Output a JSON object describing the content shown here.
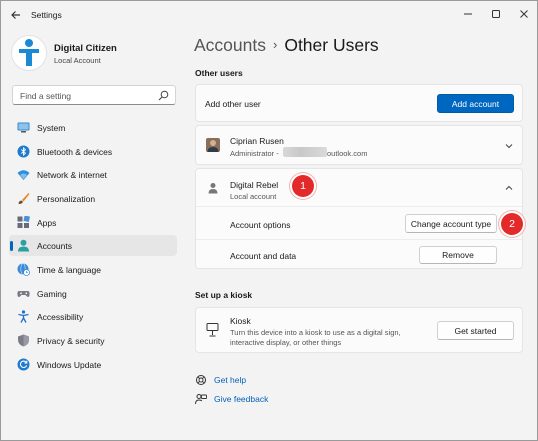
{
  "window": {
    "title": "Settings"
  },
  "profile": {
    "name": "Digital Citizen",
    "account_type": "Local Account"
  },
  "search": {
    "placeholder": "Find a setting"
  },
  "nav": {
    "items": [
      {
        "label": "System",
        "icon": "monitor-icon"
      },
      {
        "label": "Bluetooth & devices",
        "icon": "bluetooth-icon"
      },
      {
        "label": "Network & internet",
        "icon": "wifi-icon"
      },
      {
        "label": "Personalization",
        "icon": "brush-icon"
      },
      {
        "label": "Apps",
        "icon": "apps-icon"
      },
      {
        "label": "Accounts",
        "icon": "person-icon",
        "selected": true
      },
      {
        "label": "Time & language",
        "icon": "globe-clock-icon"
      },
      {
        "label": "Gaming",
        "icon": "gamepad-icon"
      },
      {
        "label": "Accessibility",
        "icon": "accessibility-icon"
      },
      {
        "label": "Privacy & security",
        "icon": "shield-icon"
      },
      {
        "label": "Windows Update",
        "icon": "update-icon"
      }
    ]
  },
  "breadcrumb": {
    "parent": "Accounts",
    "separator": "›",
    "current": "Other Users"
  },
  "other_users": {
    "heading": "Other users",
    "add_other_user_label": "Add other user",
    "add_account_button": "Add account",
    "users": [
      {
        "name": "Ciprian Rusen",
        "detail_prefix": "Administrator - ",
        "email_suffix": "outlook.com",
        "expanded": false
      },
      {
        "name": "Digital Rebel",
        "detail": "Local account",
        "expanded": true,
        "account_options_label": "Account options",
        "change_type_button": "Change account type",
        "account_data_label": "Account and data",
        "remove_button": "Remove"
      }
    ]
  },
  "kiosk": {
    "heading": "Set up a kiosk",
    "title": "Kiosk",
    "description_line1": "Turn this device into a kiosk to use as a digital sign,",
    "description_line2": "interactive display, or other things",
    "button": "Get started"
  },
  "help": {
    "get_help": "Get help",
    "give_feedback": "Give feedback"
  },
  "annotations": {
    "badge1": "1",
    "badge2": "2"
  },
  "colors": {
    "accent": "#0067c0",
    "badge": "#e32929"
  }
}
